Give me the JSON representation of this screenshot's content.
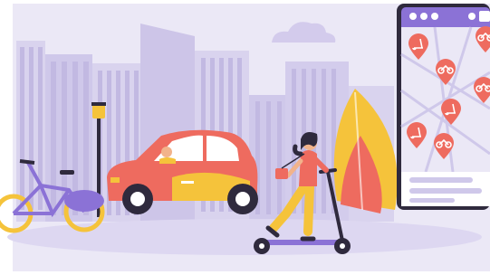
{
  "palette": {
    "background": "#ebe8f6",
    "buildings_light": "#d9d3ee",
    "buildings_mid": "#c9c1e6",
    "window": "#bfb6e0",
    "accent_red": "#ee6b5f",
    "accent_yellow": "#f5c33b",
    "accent_purple": "#8b72d6",
    "dark": "#2f2a3d",
    "white": "#ffffff"
  },
  "phone": {
    "status_dots": 3,
    "markers": [
      {
        "icon": "scooter-icon"
      },
      {
        "icon": "bike-icon"
      },
      {
        "icon": "bike-icon"
      },
      {
        "icon": "scooter-icon"
      },
      {
        "icon": "bike-icon"
      },
      {
        "icon": "scooter-icon"
      },
      {
        "icon": "bike-icon"
      }
    ]
  }
}
